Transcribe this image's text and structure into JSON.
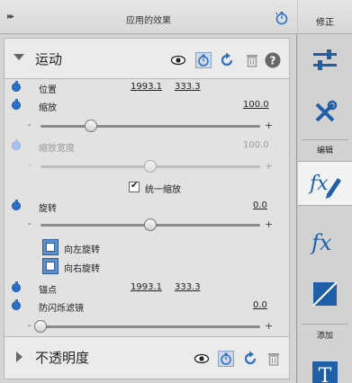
{
  "topbar": {
    "collapse_glyph": "▸▸",
    "title": "应用的效果"
  },
  "sidebar": {
    "header": "修正",
    "edit_label": "编辑",
    "add_label": "添加",
    "items": [
      {
        "icon": "adjustments-sliders-icon"
      },
      {
        "icon": "tools-wrench-icon"
      },
      {
        "icon": "fx-edit-icon"
      },
      {
        "icon": "fx-icon"
      },
      {
        "icon": "crop-diagonal-icon"
      },
      {
        "icon": "text-T-icon"
      }
    ]
  },
  "motion": {
    "title": "运动",
    "position": {
      "label": "位置",
      "x": "1993.1",
      "y": "333.3"
    },
    "scale": {
      "label": "缩放",
      "value": "100.0",
      "slider_fraction": 0.23
    },
    "scale_width": {
      "label": "缩放宽度",
      "value": "100.0",
      "slider_fraction": 0.5
    },
    "uniform_scale": {
      "label": "统一缩放",
      "checked": true
    },
    "rotation": {
      "label": "旋转",
      "value": "0.0",
      "slider_fraction": 0.5
    },
    "rotate_left": "向左旋转",
    "rotate_right": "向右旋转",
    "anchor": {
      "label": "锚点",
      "x": "1993.1",
      "y": "333.3"
    },
    "anti_flicker": {
      "label": "防闪烁滤镜",
      "value": "0.0",
      "slider_fraction": 0.0
    }
  },
  "opacity": {
    "title": "不透明度"
  },
  "colors": {
    "accent_blue": "#2a6fc9"
  }
}
